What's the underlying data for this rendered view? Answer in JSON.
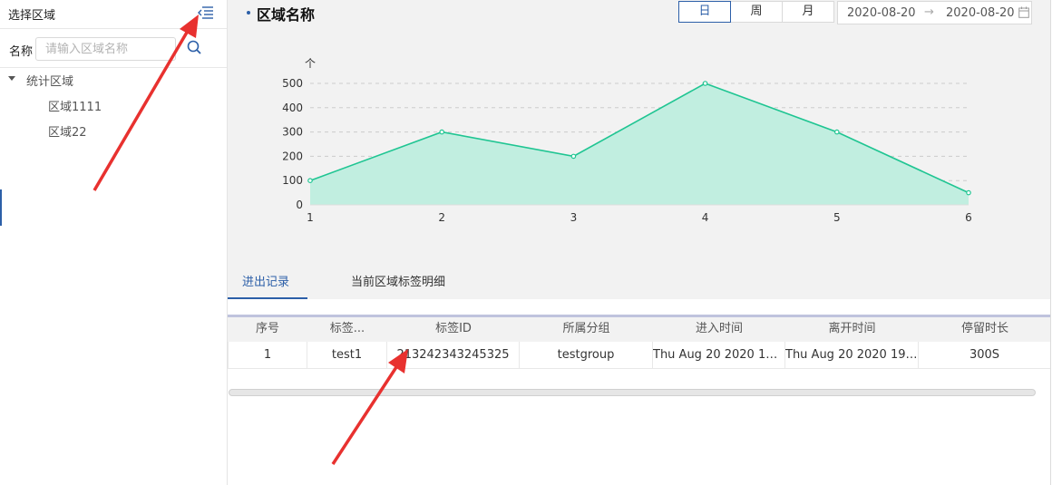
{
  "sidebar": {
    "title": "选择区域",
    "search_label": "名称",
    "search_placeholder": "请输入区域名称",
    "tree": {
      "root_label": "统计区域",
      "children": [
        "区域1111",
        "区域22"
      ]
    }
  },
  "header": {
    "title": "区域名称",
    "period_buttons": [
      "日",
      "周",
      "月"
    ],
    "active_period": "日",
    "date_start": "2020-08-20",
    "date_arrow": "→",
    "date_end": "2020-08-20"
  },
  "chart_data": {
    "type": "area",
    "x": [
      1,
      2,
      3,
      4,
      5,
      6
    ],
    "values": [
      100,
      300,
      200,
      500,
      300,
      50
    ],
    "ylabel": "个",
    "yticks": [
      0,
      100,
      200,
      300,
      400,
      500
    ],
    "ylim": [
      0,
      500
    ],
    "grid": true,
    "colors": {
      "line": "#1fc592",
      "fill": "#c1eee0"
    }
  },
  "tabs": [
    {
      "label": "进出记录",
      "active": true
    },
    {
      "label": "当前区域标签明细",
      "active": false
    }
  ],
  "table": {
    "columns": [
      "序号",
      "标签...",
      "标签ID",
      "所属分组",
      "进入时间",
      "离开时间",
      "停留时长"
    ],
    "rows": [
      [
        "1",
        "test1",
        "213242343245325",
        "testgroup",
        "Thu Aug 20 2020 19:...",
        "Thu Aug 20 2020 19:...",
        "300S"
      ]
    ]
  },
  "colors": {
    "accent": "#2c5fa8",
    "annotation": "#e8312f"
  }
}
